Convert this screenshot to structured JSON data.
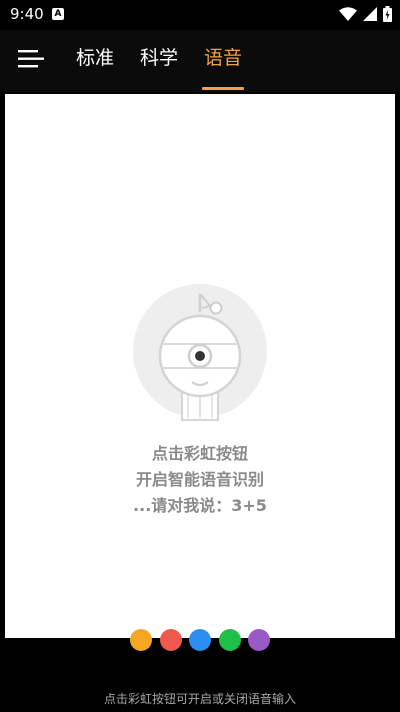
{
  "status_bar": {
    "time": "9:40",
    "notification_badge": "A"
  },
  "header": {
    "tabs": [
      {
        "label": "标准",
        "active": false
      },
      {
        "label": "科学",
        "active": false
      },
      {
        "label": "语音",
        "active": true
      }
    ],
    "accent_color": "#f0a14b"
  },
  "voice_panel": {
    "line1": "点击彩虹按钮",
    "line2": "开启智能语音识别",
    "line3": "...请对我说：3+5"
  },
  "rainbow_buttons": [
    {
      "name": "orange",
      "color": "#f5a623"
    },
    {
      "name": "red",
      "color": "#f05a4d"
    },
    {
      "name": "blue",
      "color": "#2b8ef0"
    },
    {
      "name": "green",
      "color": "#1fbf4a"
    },
    {
      "name": "purple",
      "color": "#9b59c6"
    }
  ],
  "bottom_hint": "点击彩虹按钮可开启或关闭语音输入"
}
